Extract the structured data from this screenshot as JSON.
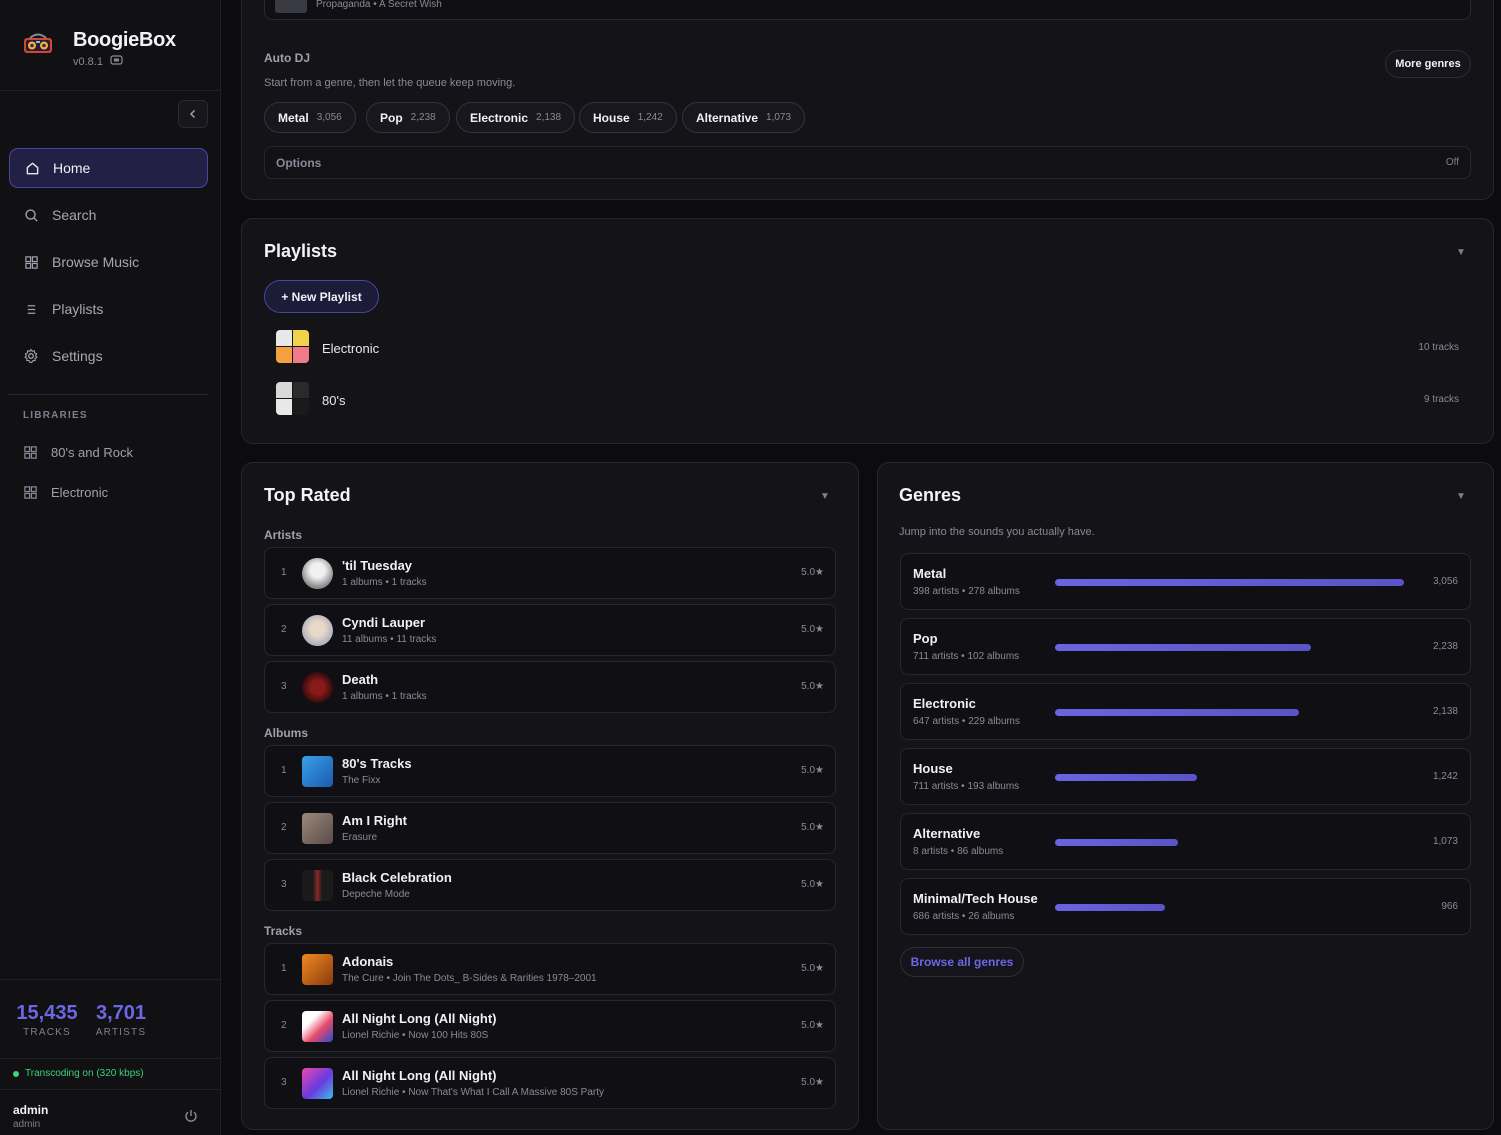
{
  "app": {
    "name": "BoogieBox",
    "version": "v0.8.1"
  },
  "nav": [
    {
      "label": "Home",
      "icon": "home-icon",
      "active": true
    },
    {
      "label": "Search",
      "icon": "search-icon"
    },
    {
      "label": "Browse Music",
      "icon": "grid-icon"
    },
    {
      "label": "Playlists",
      "icon": "list-icon"
    },
    {
      "label": "Settings",
      "icon": "gear-icon"
    }
  ],
  "libraries": {
    "heading": "LIBRARIES",
    "items": [
      "80's and Rock",
      "Electronic"
    ]
  },
  "stats": {
    "tracks": "15,435",
    "tracks_label": "TRACKS",
    "artists": "3,701",
    "artists_label": "ARTISTS"
  },
  "transcoding": "Transcoding on (320 kbps)",
  "user": {
    "name": "admin",
    "role": "admin"
  },
  "auto_dj": {
    "prev_track": "Propaganda • A Secret Wish",
    "title": "Auto DJ",
    "subtitle": "Start from a genre, then let the queue keep moving.",
    "more_genres": "More genres",
    "chips": [
      {
        "name": "Metal",
        "count": "3,056"
      },
      {
        "name": "Pop",
        "count": "2,238"
      },
      {
        "name": "Electronic",
        "count": "2,138"
      },
      {
        "name": "House",
        "count": "1,242"
      },
      {
        "name": "Alternative",
        "count": "1,073"
      }
    ],
    "options_label": "Options",
    "options_value": "Off"
  },
  "playlists": {
    "title": "Playlists",
    "new_button": "+ New Playlist",
    "items": [
      {
        "name": "Electronic",
        "count": "10 tracks"
      },
      {
        "name": "80's",
        "count": "9 tracks"
      }
    ]
  },
  "top_rated": {
    "title": "Top Rated",
    "artists_label": "Artists",
    "artists": [
      {
        "rank": "1",
        "name": "'til Tuesday",
        "sub": "1 albums • 1 tracks",
        "rating": "5.0★"
      },
      {
        "rank": "2",
        "name": "Cyndi Lauper",
        "sub": "11 albums • 11 tracks",
        "rating": "5.0★"
      },
      {
        "rank": "3",
        "name": "Death",
        "sub": "1 albums • 1 tracks",
        "rating": "5.0★"
      }
    ],
    "albums_label": "Albums",
    "albums": [
      {
        "rank": "1",
        "name": "80's Tracks",
        "sub": "The Fixx",
        "rating": "5.0★"
      },
      {
        "rank": "2",
        "name": "Am I Right",
        "sub": "Erasure",
        "rating": "5.0★"
      },
      {
        "rank": "3",
        "name": "Black Celebration",
        "sub": "Depeche Mode",
        "rating": "5.0★"
      }
    ],
    "tracks_label": "Tracks",
    "tracks": [
      {
        "rank": "1",
        "name": "Adonais",
        "sub": "The Cure • Join The Dots_ B-Sides & Rarities 1978–2001",
        "rating": "5.0★"
      },
      {
        "rank": "2",
        "name": "All Night Long (All Night)",
        "sub": "Lionel Richie • Now 100 Hits 80S",
        "rating": "5.0★"
      },
      {
        "rank": "3",
        "name": "All Night Long (All Night)",
        "sub": "Lionel Richie • Now That's What I Call A Massive 80S Party",
        "rating": "5.0★"
      }
    ]
  },
  "genres": {
    "title": "Genres",
    "subtitle": "Jump into the sounds you actually have.",
    "items": [
      {
        "name": "Metal",
        "meta": "398 artists • 278 albums",
        "count": "3,056",
        "value": 3056
      },
      {
        "name": "Pop",
        "meta": "711 artists • 102 albums",
        "count": "2,238",
        "value": 2238
      },
      {
        "name": "Electronic",
        "meta": "647 artists • 229 albums",
        "count": "2,138",
        "value": 2138
      },
      {
        "name": "House",
        "meta": "711 artists • 193 albums",
        "count": "1,242",
        "value": 1242
      },
      {
        "name": "Alternative",
        "meta": "8 artists • 86 albums",
        "count": "1,073",
        "value": 1073
      },
      {
        "name": "Minimal/Tech House",
        "meta": "686 artists • 26 albums",
        "count": "966",
        "value": 966
      }
    ],
    "browse_all": "Browse all genres"
  },
  "colors": {
    "accent": "#6c67e6",
    "active_bg": "#222044",
    "success": "#3dd17a"
  }
}
